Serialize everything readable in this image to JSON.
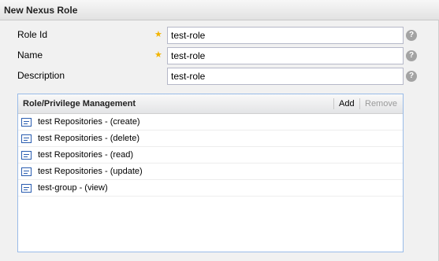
{
  "panel": {
    "title": "New Nexus Role"
  },
  "form": {
    "role_id": {
      "label": "Role Id",
      "value": "test-role",
      "required_mark": "★",
      "help": "?"
    },
    "name": {
      "label": "Name",
      "value": "test-role",
      "required_mark": "★",
      "help": "?"
    },
    "description": {
      "label": "Description",
      "value": "test-role",
      "help": "?"
    }
  },
  "grid": {
    "title": "Role/Privilege Management",
    "add_label": "Add",
    "remove_label": "Remove",
    "rows": [
      {
        "label": "test Repositories - (create)"
      },
      {
        "label": "test Repositories - (delete)"
      },
      {
        "label": "test Repositories - (read)"
      },
      {
        "label": "test Repositories - (update)"
      },
      {
        "label": "test-group - (view)"
      }
    ]
  },
  "colors": {
    "required_star": "#f2b400",
    "row_icon": "#2a5db0",
    "remove_disabled": "#9a9a9a"
  }
}
